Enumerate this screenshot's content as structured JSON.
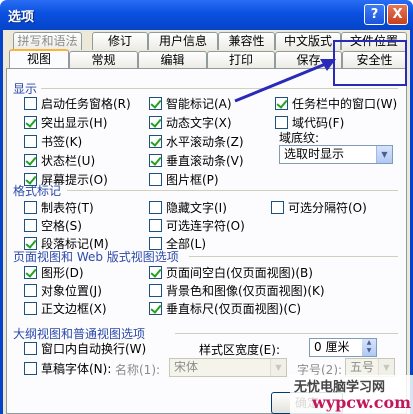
{
  "window": {
    "title": "选项",
    "help_glyph": "?",
    "close_glyph": "X",
    "title_color": "#0a50e0"
  },
  "tabs": {
    "row1": [
      "拼写和语法",
      "修订",
      "用户信息",
      "兼容性",
      "中文版式",
      "文件位置"
    ],
    "row2": [
      "视图",
      "常规",
      "编辑",
      "打印",
      "保存",
      "安全性"
    ],
    "active": "视图"
  },
  "sections": {
    "display": "显示",
    "format_marks": "格式标记",
    "page_web": "页面视图和 Web 版式视图选项",
    "outline_normal": "大纲视图和普通视图选项"
  },
  "display": {
    "col1": [
      {
        "label": "启动任务窗格(R)",
        "checked": false
      },
      {
        "label": "突出显示(H)",
        "checked": true
      },
      {
        "label": "书签(K)",
        "checked": false
      },
      {
        "label": "状态栏(U)",
        "checked": true
      },
      {
        "label": "屏幕提示(O)",
        "checked": true
      }
    ],
    "col2": [
      {
        "label": "智能标记(A)",
        "checked": true
      },
      {
        "label": "动态文字(X)",
        "checked": true
      },
      {
        "label": "水平滚动条(Z)",
        "checked": true
      },
      {
        "label": "垂直滚动条(V)",
        "checked": true
      },
      {
        "label": "图片框(P)",
        "checked": false
      }
    ],
    "col3": [
      {
        "label": "任务栏中的窗口(W)",
        "checked": true
      },
      {
        "label": "域代码(F)",
        "checked": false
      }
    ],
    "field_shading_label": "域底纹:",
    "field_shading_value": "选取时显示"
  },
  "format_marks": {
    "col1": [
      {
        "label": "制表符(T)",
        "checked": false
      },
      {
        "label": "空格(S)",
        "checked": false
      },
      {
        "label": "段落标记(M)",
        "checked": true
      }
    ],
    "col2": [
      {
        "label": "隐藏文字(I)",
        "checked": false
      },
      {
        "label": "可选连字符(O)",
        "checked": false
      },
      {
        "label": "全部(L)",
        "checked": false
      }
    ],
    "col3": [
      {
        "label": "可选分隔符(O)",
        "checked": false
      }
    ]
  },
  "page_web": {
    "col1": [
      {
        "label": "图形(D)",
        "checked": true
      },
      {
        "label": "对象位置(J)",
        "checked": false
      },
      {
        "label": "正文边框(X)",
        "checked": false
      }
    ],
    "col2": [
      {
        "label": "页面间空白(仅页面视图)(B)",
        "checked": true
      },
      {
        "label": "背景色和图像(仅页面视图)(K)",
        "checked": false
      },
      {
        "label": "垂直标尺(仅页面视图)(C)",
        "checked": true
      }
    ]
  },
  "outline_normal": {
    "wrap_label": "窗口内自动换行(W)",
    "wrap_checked": false,
    "style_width_label": "样式区宽度(E):",
    "style_width_value": "0 厘米",
    "draft_font_label": "草稿字体(N):",
    "draft_font_checked": false,
    "name_label": "名称(1):",
    "name_value": "宋体",
    "size_label": "字号(2):",
    "size_value": "五号"
  },
  "footer": {
    "ok_label": "确定"
  },
  "watermark": {
    "line1": "无忧电脑学习网",
    "line2": "wypcw.com"
  },
  "annotation_color": "#2a2ab8"
}
